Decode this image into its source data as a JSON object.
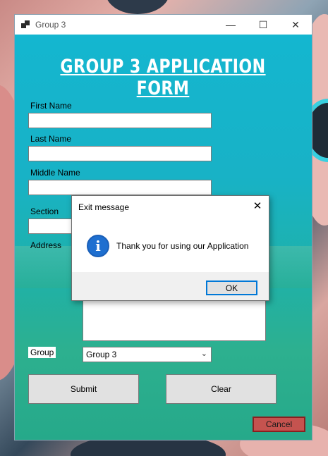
{
  "window": {
    "title": "Group 3",
    "minimize_glyph": "—",
    "maximize_glyph": "☐",
    "close_glyph": "✕"
  },
  "form": {
    "heading": "GROUP 3 APPLICATION FORM",
    "labels": {
      "first_name": "First Name",
      "last_name": "Last Name",
      "middle_name": "Middle Name",
      "section": "Section",
      "address": "Address",
      "group": "Group"
    },
    "fields": {
      "first_name": "",
      "last_name": "",
      "middle_name": "",
      "section": "",
      "address": ""
    },
    "group_selected": "Group 3",
    "buttons": {
      "submit": "Submit",
      "clear": "Clear",
      "cancel": "Cancel"
    }
  },
  "dialog": {
    "title": "Exit message",
    "message": "Thank you for using our Application",
    "ok_label": "OK",
    "close_glyph": "✕",
    "icon": "info-icon",
    "icon_glyph": "i"
  },
  "colors": {
    "form_gradient_top": "#14b6d0",
    "form_gradient_bottom": "#26a98a",
    "cancel_button": "#c5534f",
    "info_icon": "#1e6fd0",
    "dialog_ok_border": "#0078d7"
  }
}
